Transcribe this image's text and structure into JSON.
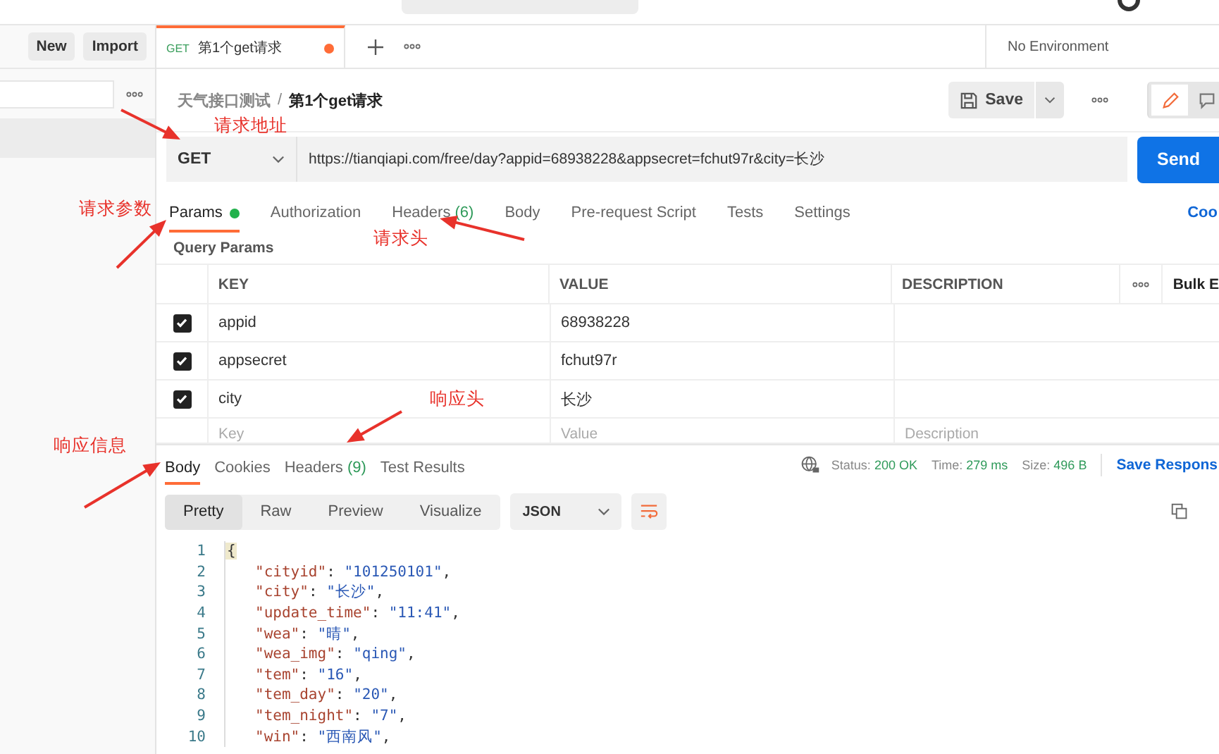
{
  "sidebar": {
    "buttons": [
      "New",
      "Import"
    ]
  },
  "tabs": [
    {
      "method": "GET",
      "title": "第1个get请求",
      "selected": true,
      "unsaved": true
    }
  ],
  "environment": "No Environment",
  "breadcrumb": {
    "parent": "天气接口测试",
    "separator": "/",
    "current": "第1个get请求"
  },
  "save_label": "Save",
  "request": {
    "method": "GET",
    "url": "https://tianqiapi.com/free/day?appid=68938228&appsecret=fchut97r&city=长沙",
    "send": "Send"
  },
  "request_tabs": [
    {
      "label": "Params",
      "dot": true,
      "selected": true
    },
    {
      "label": "Authorization",
      "dot": false,
      "selected": false
    },
    {
      "label": "Headers",
      "count": "(6)",
      "dot": false,
      "selected": false
    },
    {
      "label": "Body",
      "dot": false,
      "selected": false
    },
    {
      "label": "Pre-request Script",
      "dot": false,
      "selected": false
    },
    {
      "label": "Tests",
      "dot": false,
      "selected": false
    },
    {
      "label": "Settings",
      "dot": false,
      "selected": false
    }
  ],
  "cookies_link": "Coo",
  "query_params_label": "Query Params",
  "params_table": {
    "columns": [
      "KEY",
      "VALUE",
      "DESCRIPTION"
    ],
    "bulk_edit": "Bulk E",
    "rows": [
      {
        "checked": true,
        "key": "appid",
        "value": "68938228"
      },
      {
        "checked": true,
        "key": "appsecret",
        "value": "fchut97r"
      },
      {
        "checked": true,
        "key": "city",
        "value": "长沙"
      }
    ],
    "new_row": [
      {
        "placeholder": "Key"
      },
      {
        "placeholder": "Value"
      },
      {
        "placeholder": "Description"
      }
    ]
  },
  "response_tabs": [
    {
      "label": "Body",
      "selected": true
    },
    {
      "label": "Cookies",
      "selected": false
    },
    {
      "label": "Headers",
      "count": "(9)",
      "selected": false
    },
    {
      "label": "Test Results",
      "selected": false
    }
  ],
  "response_meta": [
    {
      "label": "Status:",
      "value": "200 OK"
    },
    {
      "label": "Time:",
      "value": "279 ms"
    },
    {
      "label": "Size:",
      "value": "496 B"
    }
  ],
  "save_response": "Save Respons",
  "view_modes": [
    {
      "label": "Pretty",
      "selected": true
    },
    {
      "label": "Raw",
      "selected": false
    },
    {
      "label": "Preview",
      "selected": false
    },
    {
      "label": "Visualize",
      "selected": false
    }
  ],
  "format": "JSON",
  "code_lines": [
    {
      "number": "1",
      "parts": [
        {
          "kind": "brace",
          "text": "{"
        }
      ]
    },
    {
      "number": "2",
      "parts": [
        {
          "kind": "key",
          "text": "\"cityid\""
        },
        {
          "kind": "punct",
          "text": ": "
        },
        {
          "kind": "string",
          "text": "\"101250101\""
        },
        {
          "kind": "punct",
          "text": ","
        }
      ]
    },
    {
      "number": "3",
      "parts": [
        {
          "kind": "key",
          "text": "\"city\""
        },
        {
          "kind": "punct",
          "text": ": "
        },
        {
          "kind": "string",
          "text": "\"长沙\""
        },
        {
          "kind": "punct",
          "text": ","
        }
      ]
    },
    {
      "number": "4",
      "parts": [
        {
          "kind": "key",
          "text": "\"update_time\""
        },
        {
          "kind": "punct",
          "text": ": "
        },
        {
          "kind": "string",
          "text": "\"11:41\""
        },
        {
          "kind": "punct",
          "text": ","
        }
      ]
    },
    {
      "number": "5",
      "parts": [
        {
          "kind": "key",
          "text": "\"wea\""
        },
        {
          "kind": "punct",
          "text": ": "
        },
        {
          "kind": "string",
          "text": "\"晴\""
        },
        {
          "kind": "punct",
          "text": ","
        }
      ]
    },
    {
      "number": "6",
      "parts": [
        {
          "kind": "key",
          "text": "\"wea_img\""
        },
        {
          "kind": "punct",
          "text": ": "
        },
        {
          "kind": "string",
          "text": "\"qing\""
        },
        {
          "kind": "punct",
          "text": ","
        }
      ]
    },
    {
      "number": "7",
      "parts": [
        {
          "kind": "key",
          "text": "\"tem\""
        },
        {
          "kind": "punct",
          "text": ": "
        },
        {
          "kind": "string",
          "text": "\"16\""
        },
        {
          "kind": "punct",
          "text": ","
        }
      ]
    },
    {
      "number": "8",
      "parts": [
        {
          "kind": "key",
          "text": "\"tem_day\""
        },
        {
          "kind": "punct",
          "text": ": "
        },
        {
          "kind": "string",
          "text": "\"20\""
        },
        {
          "kind": "punct",
          "text": ","
        }
      ]
    },
    {
      "number": "9",
      "parts": [
        {
          "kind": "key",
          "text": "\"tem_night\""
        },
        {
          "kind": "punct",
          "text": ": "
        },
        {
          "kind": "string",
          "text": "\"7\""
        },
        {
          "kind": "punct",
          "text": ","
        }
      ]
    },
    {
      "number": "10",
      "parts": [
        {
          "kind": "key",
          "text": "\"win\""
        },
        {
          "kind": "punct",
          "text": ": "
        },
        {
          "kind": "string",
          "text": "\"西南风\""
        },
        {
          "kind": "punct",
          "text": ","
        }
      ]
    }
  ],
  "annotations": [
    {
      "text": "请求地址"
    },
    {
      "text": "请求参数"
    },
    {
      "text": "请求头"
    },
    {
      "text": "响应头"
    },
    {
      "text": "响应信息"
    }
  ]
}
